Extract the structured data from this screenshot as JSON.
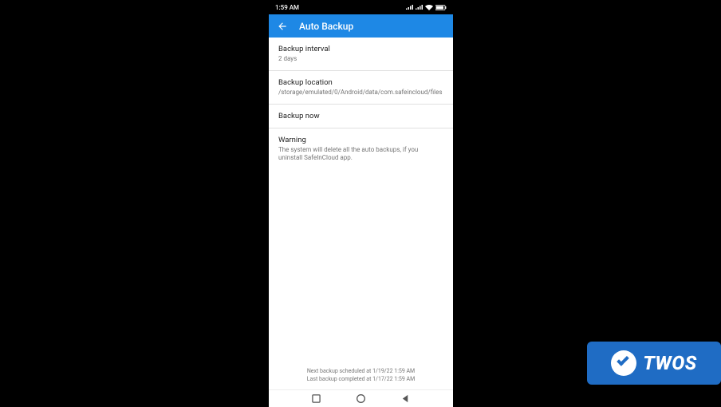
{
  "status_bar": {
    "time": "1:59 AM"
  },
  "app_bar": {
    "title": "Auto Backup"
  },
  "rows": {
    "interval": {
      "title": "Backup interval",
      "value": "2 days"
    },
    "location": {
      "title": "Backup location",
      "value": "/storage/emulated/0/Android/data/com.safeincloud/files"
    },
    "now": {
      "title": "Backup now"
    },
    "warning": {
      "title": "Warning",
      "value": "The system will delete all the auto backups, if you uninstall SafeInCloud app."
    }
  },
  "footer": {
    "next": "Next backup scheduled at 1/19/22 1:59 AM",
    "last": "Last backup completed at 1/17/22 1:59 AM"
  },
  "badge": {
    "text": "TWOS"
  }
}
